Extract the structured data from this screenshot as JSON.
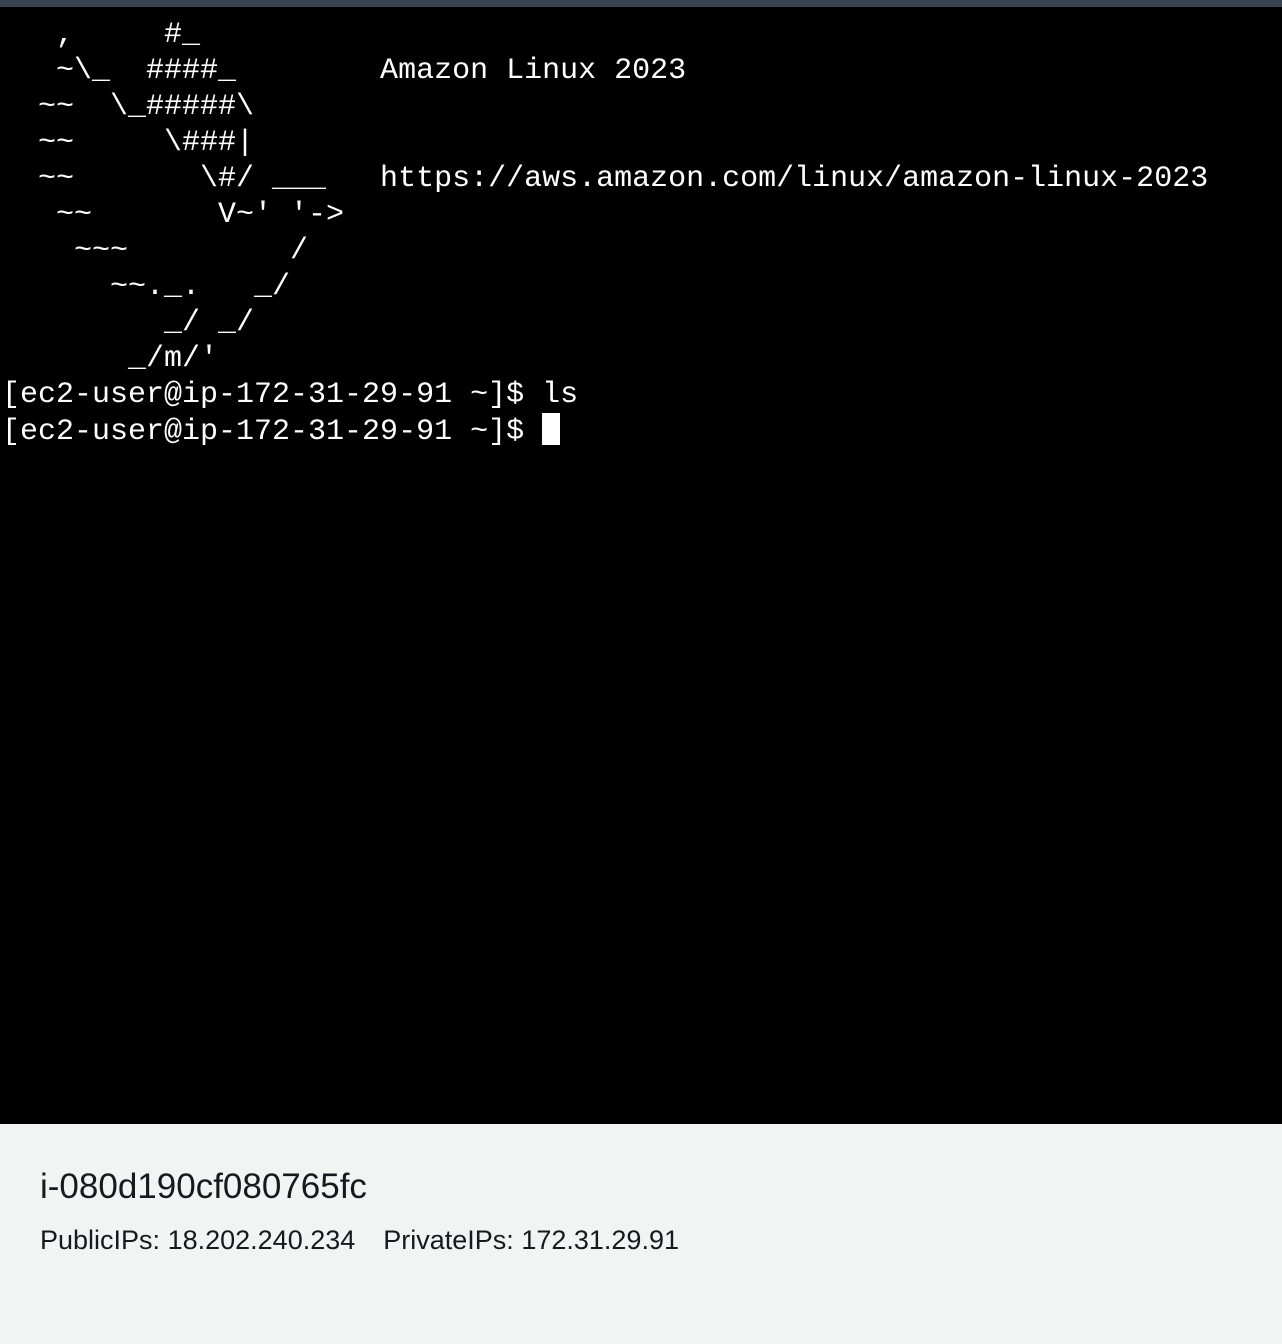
{
  "colors": {
    "terminal_bg": "#000000",
    "terminal_fg": "#ffffff",
    "footer_bg": "#f2f3f3",
    "footer_text": "#16191f",
    "top_border": "#3b4452"
  },
  "terminal": {
    "lines": [
      "   ,     #_",
      "   ~\\_  ####_        Amazon Linux 2023",
      "  ~~  \\_#####\\",
      "  ~~     \\###|",
      "  ~~       \\#/ ___   https://aws.amazon.com/linux/amazon-linux-2023",
      "   ~~       V~' '->",
      "    ~~~         /",
      "      ~~._.   _/",
      "         _/ _/",
      "       _/m/'",
      "[ec2-user@ip-172-31-29-91 ~]$ ls"
    ],
    "prompt": "[ec2-user@ip-172-31-29-91 ~]$ "
  },
  "instance": {
    "id": "i-080d190cf080765fc",
    "public_ips_label": "PublicIPs:",
    "public_ips_value": "18.202.240.234",
    "private_ips_label": "PrivateIPs:",
    "private_ips_value": "172.31.29.91"
  }
}
